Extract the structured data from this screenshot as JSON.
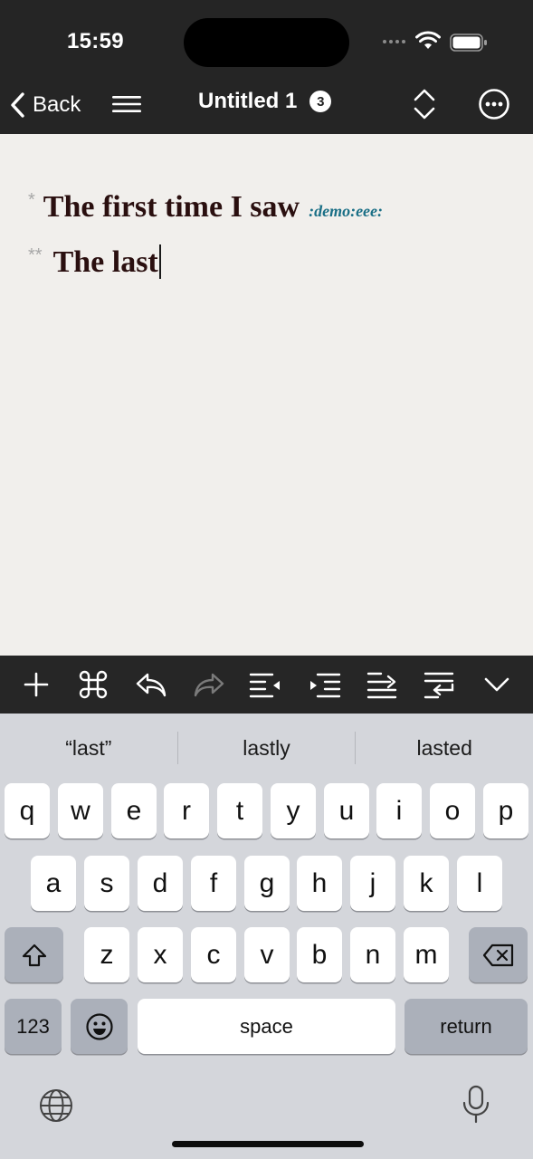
{
  "status": {
    "time": "15:59"
  },
  "nav": {
    "back_label": "Back",
    "title": "Untitled 1",
    "badge": "3"
  },
  "editor": {
    "line1": {
      "marker": "*",
      "text": "The first time I saw",
      "tag": ":demo:eee:"
    },
    "line2": {
      "marker": "**",
      "text": "The last"
    }
  },
  "toolbar": {
    "buttons": [
      "plus-icon",
      "command-icon",
      "undo-icon",
      "redo-icon",
      "outdent-icon",
      "indent-icon",
      "move-up-icon",
      "move-down-icon",
      "hide-keyboard-icon"
    ]
  },
  "suggestions": [
    "“last”",
    "lastly",
    "lasted"
  ],
  "keyboard": {
    "row1": [
      "q",
      "w",
      "e",
      "r",
      "t",
      "y",
      "u",
      "i",
      "o",
      "p"
    ],
    "row2": [
      "a",
      "s",
      "d",
      "f",
      "g",
      "h",
      "j",
      "k",
      "l"
    ],
    "row3": [
      "z",
      "x",
      "c",
      "v",
      "b",
      "n",
      "m"
    ],
    "numbers_label": "123",
    "space_label": "space",
    "return_label": "return"
  },
  "colors": {
    "bar": "#252525",
    "paper": "#f1efec",
    "text": "#2a0f0f",
    "tag": "#1a6f86",
    "keyboard_bg": "#d4d6db"
  }
}
